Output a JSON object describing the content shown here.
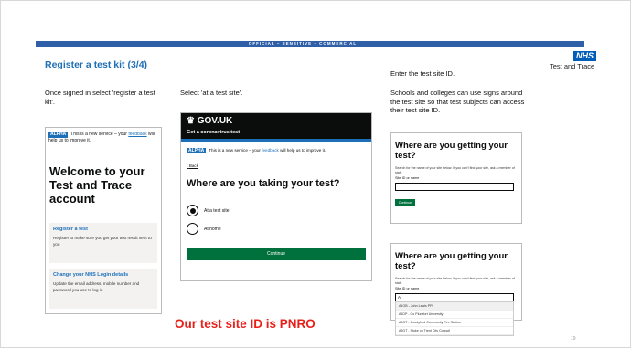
{
  "slide": {
    "classification": "OFFICIAL – SENSITIVE – COMMERCIAL",
    "title": "Register a test kit (3/4)",
    "brand": {
      "logo": "NHS",
      "subtitle": "Test and Trace"
    },
    "highlight": "Our test site ID is PNRO",
    "page_number": "19"
  },
  "columns": [
    {
      "caption": "Once signed in select 'register a test kit'."
    },
    {
      "caption": "Select 'at a test site'."
    },
    {
      "caption_1": "Enter the test site ID.",
      "caption_2": "Schools and colleges can use signs around the test site so that test subjects can access their test site ID."
    }
  ],
  "phone1": {
    "phase_tag": "ALPHA",
    "banner_prefix": "This is a new service – your",
    "banner_link": "feedback",
    "banner_suffix": "will help us to improve it.",
    "heading": "Welcome to your Test and Trace account",
    "cards": [
      {
        "title": "Register a test",
        "body": "Register to make sure you get your test result sent to you"
      },
      {
        "title": "Change your NHS Login details",
        "body": "Update the email address, mobile number and password you use to log in"
      }
    ]
  },
  "phone2": {
    "logo": "GOV.UK",
    "service": "Get a coronavirus test",
    "phase_tag": "ALPHA",
    "banner_prefix": "This is a new service – your",
    "banner_link": "feedback",
    "banner_suffix": "will help us to improve it.",
    "back": "Back",
    "question": "Where are you taking your test?",
    "options": [
      {
        "label": "At a test site",
        "selected": true
      },
      {
        "label": "At home",
        "selected": false
      }
    ],
    "continue": "Continue"
  },
  "panel1": {
    "question": "Where are you getting your test?",
    "hint": "Search for the name of your site below. If you can't find your site, ask a member of staff.",
    "field_label": "Site ID or name",
    "field_value": "",
    "button": "Continue"
  },
  "panel2": {
    "question": "Where are you getting your test?",
    "hint": "Search for the name of your site below. If you can't find your site, ask a member of staff.",
    "field_label": "Site ID or name",
    "field_value": "A",
    "suggestions": [
      "A1OB - John Lewis PPI",
      "A1DP - Go Plumfort University",
      "A5GT - Goodyford Community Fire Station",
      "A5GT - Stoke on Trent City Council"
    ]
  }
}
